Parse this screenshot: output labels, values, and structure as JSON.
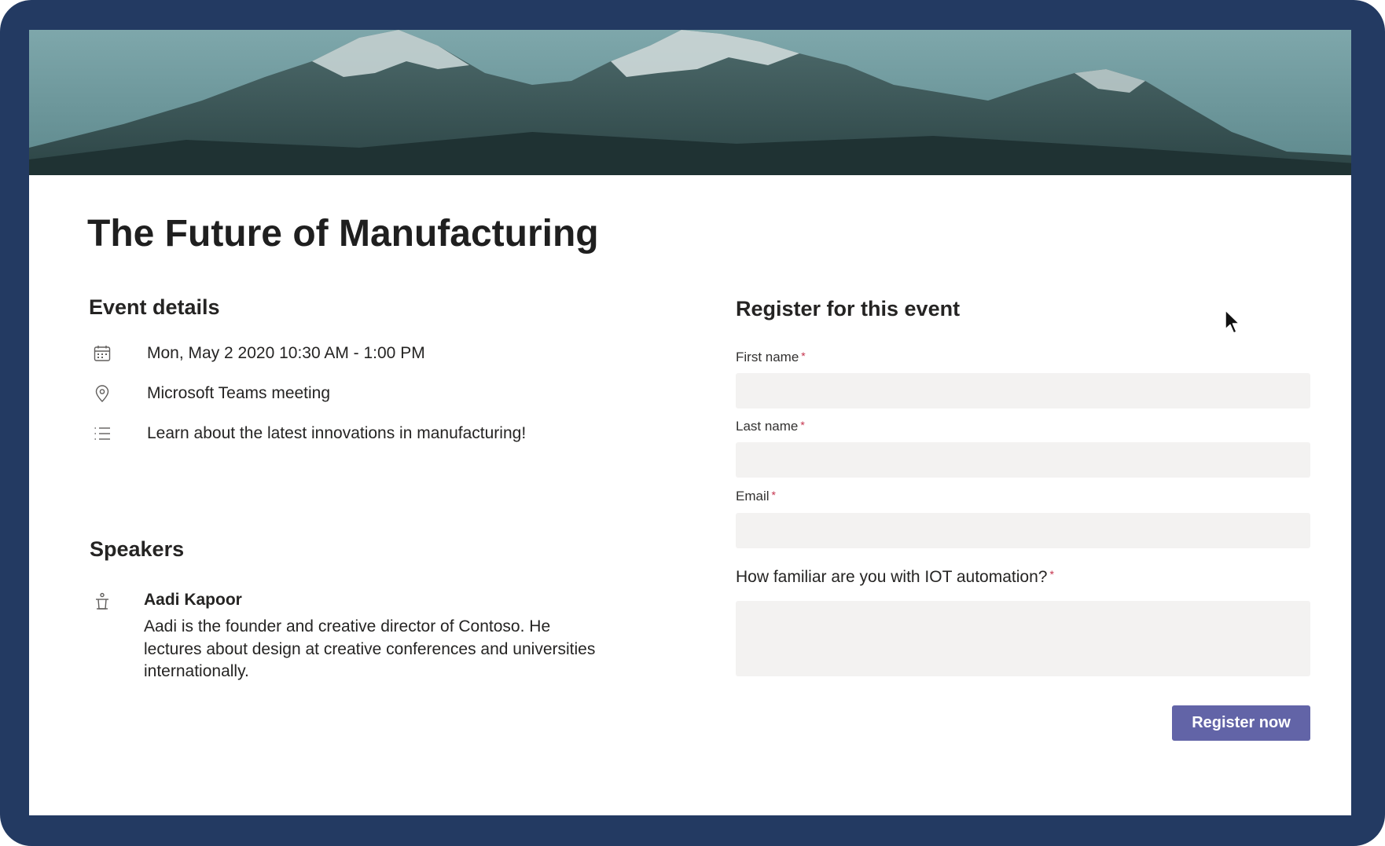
{
  "event": {
    "title": "The Future of Manufacturing"
  },
  "details": {
    "heading": "Event details",
    "items": [
      {
        "icon": "calendar-icon",
        "text": "Mon, May 2 2020 10:30 AM - 1:00 PM"
      },
      {
        "icon": "location-pin-icon",
        "text": "Microsoft Teams meeting"
      },
      {
        "icon": "list-icon",
        "text": "Learn about the latest innovations in manufacturing!"
      }
    ]
  },
  "speakers": {
    "heading": "Speakers",
    "items": [
      {
        "icon": "podium-icon",
        "name": "Aadi Kapoor",
        "bio": "Aadi is the founder and creative director of Contoso. He lectures about design at creative conferences and universities internationally."
      }
    ]
  },
  "register": {
    "heading": "Register for this event",
    "required_marker": "*",
    "fields": [
      {
        "label": "First name",
        "value": "",
        "placeholder": ""
      },
      {
        "label": "Last name",
        "value": "",
        "placeholder": ""
      },
      {
        "label": "Email",
        "value": "",
        "placeholder": ""
      },
      {
        "label": "How familiar are you with IOT automation?",
        "value": "",
        "placeholder": ""
      }
    ],
    "button_label": "Register now"
  },
  "colors": {
    "frame": "#233a62",
    "accent": "#6264a7",
    "required": "#c4314b",
    "field_bg": "#f3f2f1"
  }
}
